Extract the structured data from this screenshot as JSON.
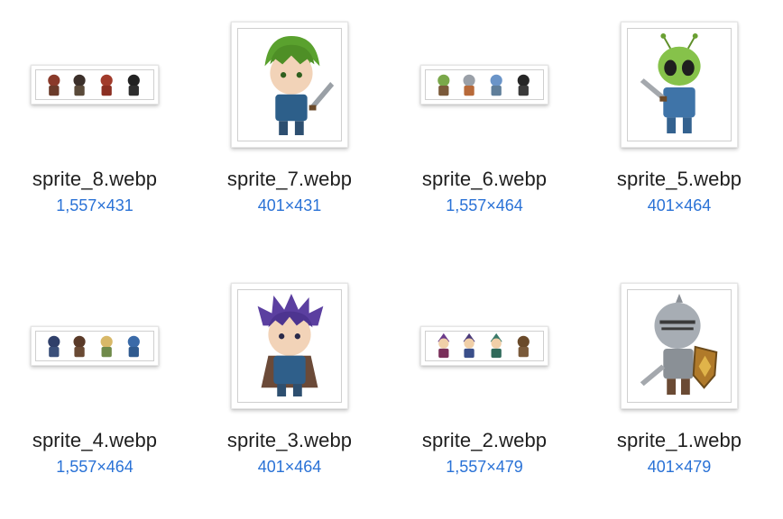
{
  "files": [
    {
      "name": "sprite_8.webp",
      "dimensions": "1,557×431",
      "icon": "ninja-squad-sprite-thumbnail"
    },
    {
      "name": "sprite_7.webp",
      "dimensions": "401×431",
      "icon": "green-hair-swordsman-thumbnail"
    },
    {
      "name": "sprite_6.webp",
      "dimensions": "1,557×464",
      "icon": "alien-robot-sprite-thumbnail"
    },
    {
      "name": "sprite_5.webp",
      "dimensions": "401×464",
      "icon": "green-alien-thumbnail"
    },
    {
      "name": "sprite_4.webp",
      "dimensions": "1,557×464",
      "icon": "adventurer-party-sprite-thumbnail"
    },
    {
      "name": "sprite_3.webp",
      "dimensions": "401×464",
      "icon": "purple-hair-hero-thumbnail"
    },
    {
      "name": "sprite_2.webp",
      "dimensions": "1,557×479",
      "icon": "wizard-party-sprite-thumbnail"
    },
    {
      "name": "sprite_1.webp",
      "dimensions": "401×479",
      "icon": "armored-knight-thumbnail"
    }
  ],
  "colors": {
    "dimension_text": "#2a72d6",
    "filename_text": "#1f1f1f"
  }
}
